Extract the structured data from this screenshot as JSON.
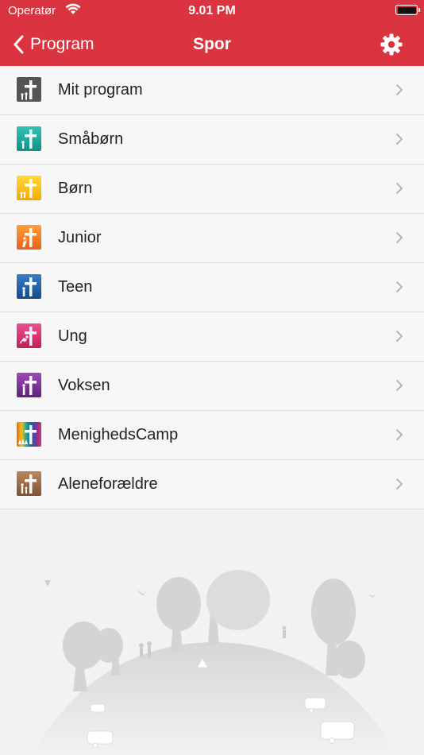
{
  "status": {
    "carrier": "Operatør",
    "time": "9.01 PM"
  },
  "nav": {
    "back_label": "Program",
    "title": "Spor"
  },
  "rows": [
    {
      "label": "Mit program",
      "color": "#555555"
    },
    {
      "label": "Småbørn",
      "color": "#1aa39a"
    },
    {
      "label": "Børn",
      "color": "#f5c21b"
    },
    {
      "label": "Junior",
      "color": "#f07a1e"
    },
    {
      "label": "Teen",
      "color": "#1f5ea8"
    },
    {
      "label": "Ung",
      "color": "#d6336e"
    },
    {
      "label": "Voksen",
      "color": "#7a3596"
    },
    {
      "label": "MenighedsCamp",
      "color": "#multicolor"
    },
    {
      "label": "Aleneforældre",
      "color": "#9a6a45"
    }
  ],
  "colors": {
    "brand": "#d9343f"
  }
}
